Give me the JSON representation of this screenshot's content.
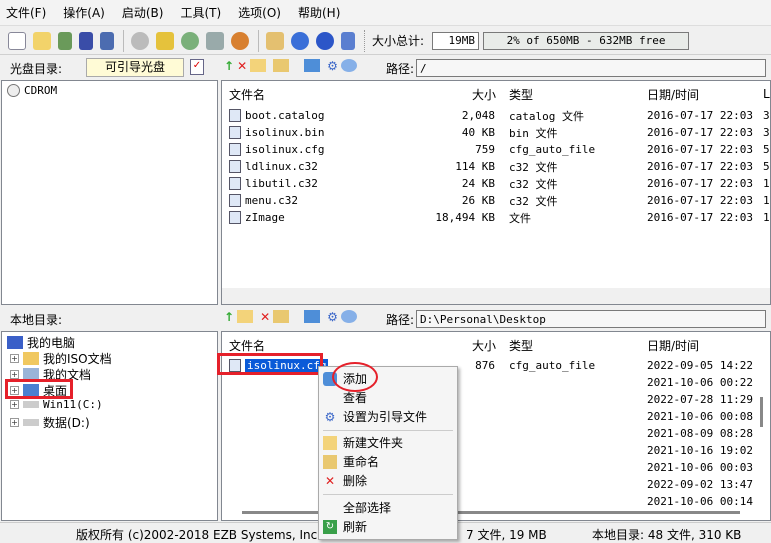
{
  "menu": [
    "文件(F)",
    "操作(A)",
    "启动(B)",
    "工具(T)",
    "选项(O)",
    "帮助(H)"
  ],
  "toolbar": {
    "size_label": "大小总计:",
    "size_value": "19MB",
    "capacity_text": "2% of 650MB - 632MB free",
    "capacity_percent": 2
  },
  "iso_bar": {
    "label": "光盘目录:",
    "bootable": "可引导光盘",
    "path_label": "路径:",
    "path": "/"
  },
  "iso_tree": {
    "root": "CDROM"
  },
  "columns": {
    "name": "文件名",
    "size": "大小",
    "type": "类型",
    "date": "日期/时间",
    "extra": "L"
  },
  "iso_files": [
    {
      "name": "boot.catalog",
      "size": "2,048",
      "type": "catalog 文件",
      "date": "2016-07-17 22:03",
      "extra": "3"
    },
    {
      "name": "isolinux.bin",
      "size": "40 KB",
      "type": "bin 文件",
      "date": "2016-07-17 22:03",
      "extra": "3"
    },
    {
      "name": "isolinux.cfg",
      "size": "759",
      "type": "cfg_auto_file",
      "date": "2016-07-17 22:03",
      "extra": "5"
    },
    {
      "name": "ldlinux.c32",
      "size": "114 KB",
      "type": "c32 文件",
      "date": "2016-07-17 22:03",
      "extra": "5"
    },
    {
      "name": "libutil.c32",
      "size": "24 KB",
      "type": "c32 文件",
      "date": "2016-07-17 22:03",
      "extra": "1"
    },
    {
      "name": "menu.c32",
      "size": "26 KB",
      "type": "c32 文件",
      "date": "2016-07-17 22:03",
      "extra": "1"
    },
    {
      "name": "zImage",
      "size": "18,494 KB",
      "type": "文件",
      "date": "2016-07-17 22:03",
      "extra": "1"
    }
  ],
  "local_bar": {
    "label": "本地目录:",
    "path_label": "路径:",
    "path": "D:\\Personal\\Desktop"
  },
  "local_tree": [
    "我的电脑",
    "我的ISO文档",
    "我的文档",
    "桌面",
    "Win11(C:)",
    "数据(D:)"
  ],
  "local_files": [
    {
      "name": "isolinux.cfg",
      "size": "876",
      "type": "cfg_auto_file",
      "date": "2022-09-05 14:22"
    },
    {
      "date": "2021-10-06 00:22"
    },
    {
      "date": "2022-07-28 11:29"
    },
    {
      "date": "2021-10-06 00:08"
    },
    {
      "date": "2021-08-09 08:28"
    },
    {
      "date": "2021-10-16 19:02"
    },
    {
      "date": "2021-10-06 00:03"
    },
    {
      "date": "2022-09-02 13:47"
    },
    {
      "date": "2021-10-06 00:14"
    }
  ],
  "context_menu": [
    "添加",
    "查看",
    "设置为引导文件",
    "新建文件夹",
    "重命名",
    "删除",
    "全部选择",
    "刷新"
  ],
  "status": {
    "copyright": "版权所有 (c)2002-2018 EZB Systems, Inc.",
    "iso_summary": "7 文件, 19 MB",
    "local_summary": "本地目录: 48 文件, 310 KB"
  }
}
